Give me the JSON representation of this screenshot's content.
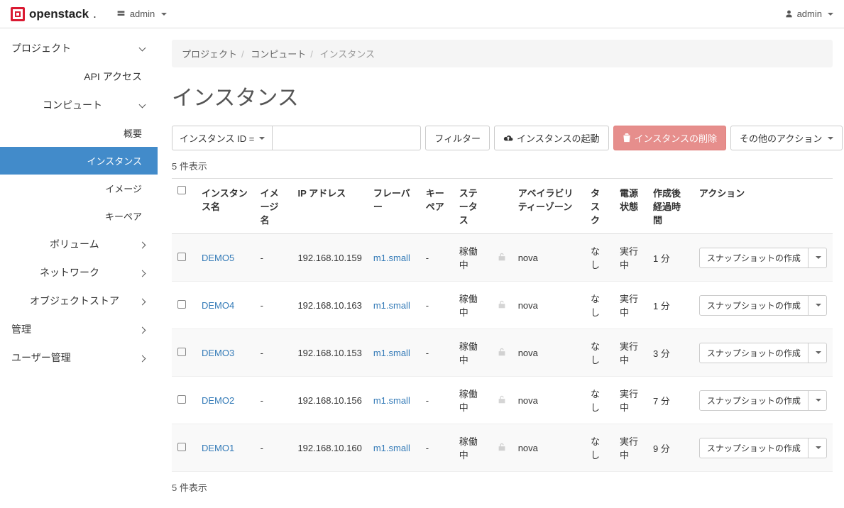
{
  "header": {
    "brand": "openstack",
    "project": "admin",
    "user": "admin"
  },
  "sidebar": {
    "project": "プロジェクト",
    "apiAccess": "API アクセス",
    "compute": "コンピュート",
    "overview": "概要",
    "instances": "インスタンス",
    "images": "イメージ",
    "keypairs": "キーペア",
    "volumes": "ボリューム",
    "network": "ネットワーク",
    "objectStore": "オブジェクトストア",
    "admin": "管理",
    "identity": "ユーザー管理"
  },
  "breadcrumb": {
    "a": "プロジェクト",
    "b": "コンピュート",
    "c": "インスタンス"
  },
  "page": {
    "title": "インスタンス"
  },
  "filter": {
    "label": "インスタンス ID ="
  },
  "buttons": {
    "filter": "フィルター",
    "launch": "インスタンスの起動",
    "delete": "インスタンスの削除",
    "other": "その他のアクション",
    "snapshot": "スナップショットの作成"
  },
  "count": "5 件表示",
  "columns": {
    "name": "インスタンス名",
    "image": "イメージ名",
    "ip": "IP アドレス",
    "flavor": "フレーバー",
    "keypair": "キーペア",
    "status": "ステータス",
    "az": "アベイラビリティーゾーン",
    "task": "タスク",
    "power": "電源状態",
    "age": "作成後経過時間",
    "actions": "アクション"
  },
  "rows": [
    {
      "name": "DEMO5",
      "image": "-",
      "ip": "192.168.10.159",
      "flavor": "m1.small",
      "keypair": "-",
      "status": "稼働中",
      "az": "nova",
      "task": "なし",
      "power": "実行中",
      "age": "1 分"
    },
    {
      "name": "DEMO4",
      "image": "-",
      "ip": "192.168.10.163",
      "flavor": "m1.small",
      "keypair": "-",
      "status": "稼働中",
      "az": "nova",
      "task": "なし",
      "power": "実行中",
      "age": "1 分"
    },
    {
      "name": "DEMO3",
      "image": "-",
      "ip": "192.168.10.153",
      "flavor": "m1.small",
      "keypair": "-",
      "status": "稼働中",
      "az": "nova",
      "task": "なし",
      "power": "実行中",
      "age": "3 分"
    },
    {
      "name": "DEMO2",
      "image": "-",
      "ip": "192.168.10.156",
      "flavor": "m1.small",
      "keypair": "-",
      "status": "稼働中",
      "az": "nova",
      "task": "なし",
      "power": "実行中",
      "age": "7 分"
    },
    {
      "name": "DEMO1",
      "image": "-",
      "ip": "192.168.10.160",
      "flavor": "m1.small",
      "keypair": "-",
      "status": "稼働中",
      "az": "nova",
      "task": "なし",
      "power": "実行中",
      "age": "9 分"
    }
  ]
}
